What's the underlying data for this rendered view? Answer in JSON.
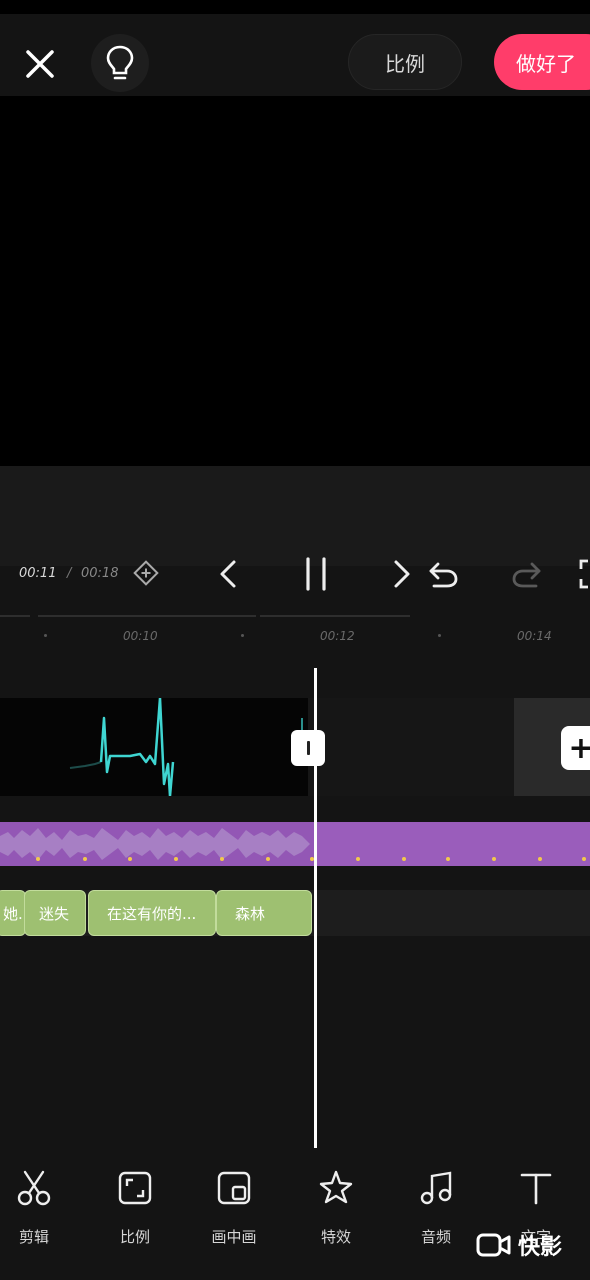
{
  "header": {
    "close_icon": "close-icon",
    "idea_icon": "lightbulb-icon",
    "ratio_label": "比例",
    "done_label": "做好了",
    "done_color": "#ff3d6a"
  },
  "playback": {
    "current_time": "00:11",
    "separator": "/",
    "total_time": "00:18",
    "keyframe_icon": "keyframe-diamond-icon",
    "prev_icon": "chevron-left-icon",
    "pause_icon": "pause-icon",
    "next_icon": "chevron-right-icon",
    "undo_icon": "undo-icon",
    "redo_icon": "redo-icon"
  },
  "ruler": {
    "ticks": [
      "00:10",
      "00:12",
      "00:14"
    ]
  },
  "tracks": {
    "audio_color": "#9357b5",
    "subtitle_color": "#9ec071",
    "subtitles": [
      "她.",
      "迷失",
      "在这有你的...",
      "森林"
    ]
  },
  "toolbar": {
    "items": [
      {
        "label": "剪辑",
        "icon": "scissors-icon"
      },
      {
        "label": "比例",
        "icon": "aspect-ratio-icon"
      },
      {
        "label": "画中画",
        "icon": "picture-in-picture-icon"
      },
      {
        "label": "特效",
        "icon": "sparkle-star-icon"
      },
      {
        "label": "音频",
        "icon": "music-note-icon"
      },
      {
        "label": "文字",
        "icon": "text-icon"
      }
    ]
  },
  "watermark": {
    "text": "快影",
    "icon": "camera-logo-icon"
  }
}
